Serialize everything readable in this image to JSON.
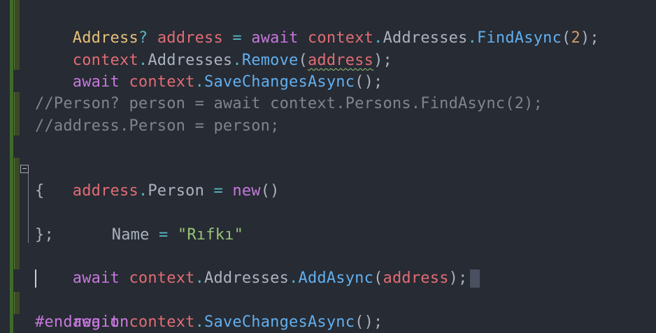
{
  "editor": {
    "line1": {
      "type": "Address",
      "nullable": "?",
      "var": "address",
      "eq": "=",
      "await": "await",
      "ctx": "context",
      "dot1": ".",
      "prop": "Addresses",
      "dot2": ".",
      "method": "FindAsync",
      "open": "(",
      "arg": "2",
      "close": ");"
    },
    "line2": {
      "ctx": "context",
      "dot1": ".",
      "prop": "Addresses",
      "dot2": ".",
      "method": "Remove",
      "open": "(",
      "arg": "address",
      "close": ");"
    },
    "line3": {
      "await": "await",
      "ctx": "context",
      "dot": ".",
      "method": "SaveChangesAsync",
      "close": "();"
    },
    "comment1": "//Person? person = await context.Persons.FindAsync(2);",
    "comment2": "//address.Person = person;",
    "line6": {
      "var": "address",
      "dot": ".",
      "prop": "Person",
      "eq": "=",
      "kw": "new",
      "close": "()"
    },
    "brace_open": "{",
    "line8": {
      "prop": "Name",
      "eq": "=",
      "str": "\"Rıfkı\""
    },
    "brace_close": "};",
    "line10": {
      "await": "await",
      "ctx": "context",
      "dot1": ".",
      "prop": "Addresses",
      "dot2": ".",
      "method": "AddAsync",
      "open": "(",
      "arg": "address",
      "close": ");"
    },
    "line12": {
      "await": "await",
      "ctx": "context",
      "dot": ".",
      "method": "SaveChangesAsync",
      "close": "();"
    },
    "region": "#endregion"
  },
  "colors": {
    "background": "#272b33",
    "keyword": "#e06c75",
    "method": "#61afef",
    "type": "#e5c07b",
    "string": "#98c379",
    "number": "#d19a66",
    "comment": "#7f848e"
  }
}
